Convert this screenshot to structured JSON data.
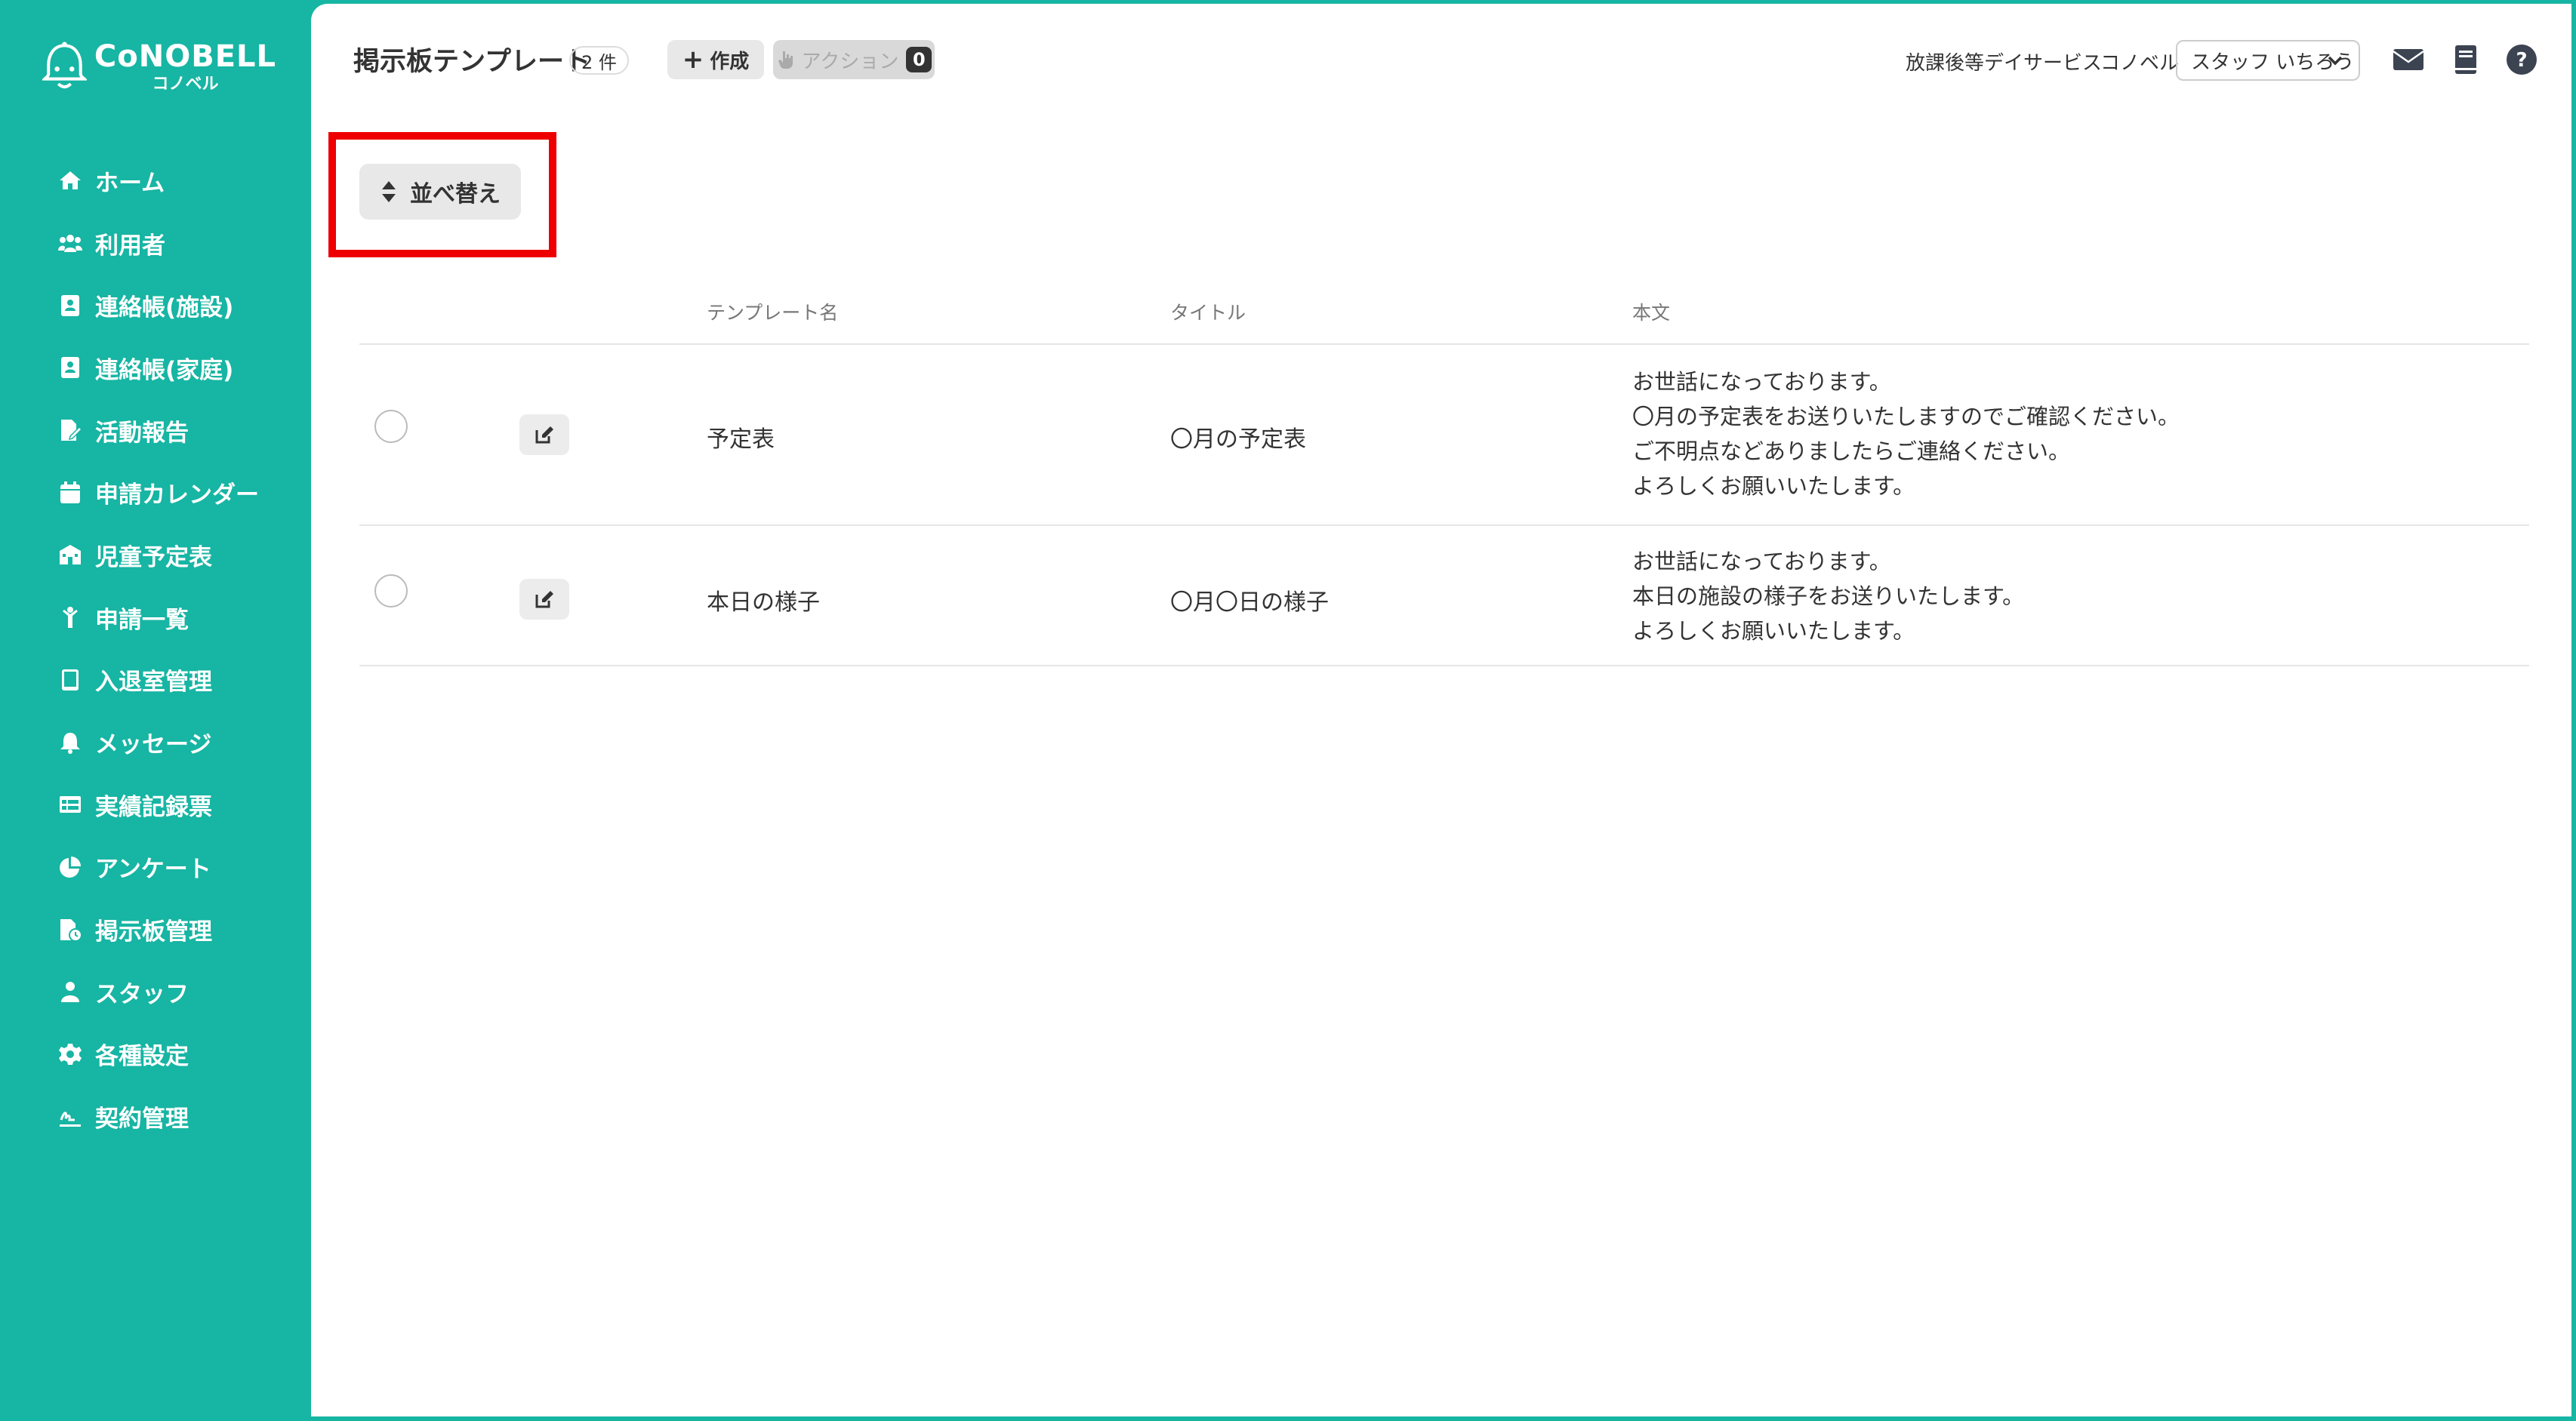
{
  "brand": {
    "name": "CoNOBELL",
    "sub": "コノベル"
  },
  "sidebar": {
    "items": [
      {
        "label": "ホーム",
        "icon": "home-icon"
      },
      {
        "label": "利用者",
        "icon": "users-icon"
      },
      {
        "label": "連絡帳(施設)",
        "icon": "contact-book-icon"
      },
      {
        "label": "連絡帳(家庭)",
        "icon": "contact-book-icon"
      },
      {
        "label": "活動報告",
        "icon": "file-edit-icon"
      },
      {
        "label": "申請カレンダー",
        "icon": "calendar-icon"
      },
      {
        "label": "児童予定表",
        "icon": "school-icon"
      },
      {
        "label": "申請一覧",
        "icon": "child-icon"
      },
      {
        "label": "入退室管理",
        "icon": "tablet-icon"
      },
      {
        "label": "メッセージ",
        "icon": "bell-icon"
      },
      {
        "label": "実績記録票",
        "icon": "table-icon"
      },
      {
        "label": "アンケート",
        "icon": "pie-chart-icon"
      },
      {
        "label": "掲示板管理",
        "icon": "file-clock-icon"
      },
      {
        "label": "スタッフ",
        "icon": "staff-icon"
      },
      {
        "label": "各種設定",
        "icon": "gear-icon"
      },
      {
        "label": "契約管理",
        "icon": "signature-icon"
      }
    ]
  },
  "header": {
    "title": "掲示板テンプレート",
    "count": "2 件",
    "create_label": "作成",
    "action_label": "アクション",
    "action_count": "0",
    "facility": "放課後等デイサービス",
    "org": "コノベル",
    "staff": "スタッフ いちろう"
  },
  "toolbar": {
    "sort_label": "並べ替え"
  },
  "table": {
    "headers": {
      "name": "テンプレート名",
      "title": "タイトル",
      "body": "本文"
    },
    "rows": [
      {
        "name": "予定表",
        "title": "〇月の予定表",
        "body": "お世話になっております。\n〇月の予定表をお送りいたしますのでご確認ください。\nご不明点などありましたらご連絡ください。\nよろしくお願いいたします。"
      },
      {
        "name": "本日の様子",
        "title": "〇月〇日の様子",
        "body": "お世話になっております。\n本日の施設の様子をお送りいたします。\nよろしくお願いいたします。"
      }
    ]
  },
  "colors": {
    "brand": "#17b5a3",
    "highlight": "#ee0000",
    "text": "#333333"
  }
}
